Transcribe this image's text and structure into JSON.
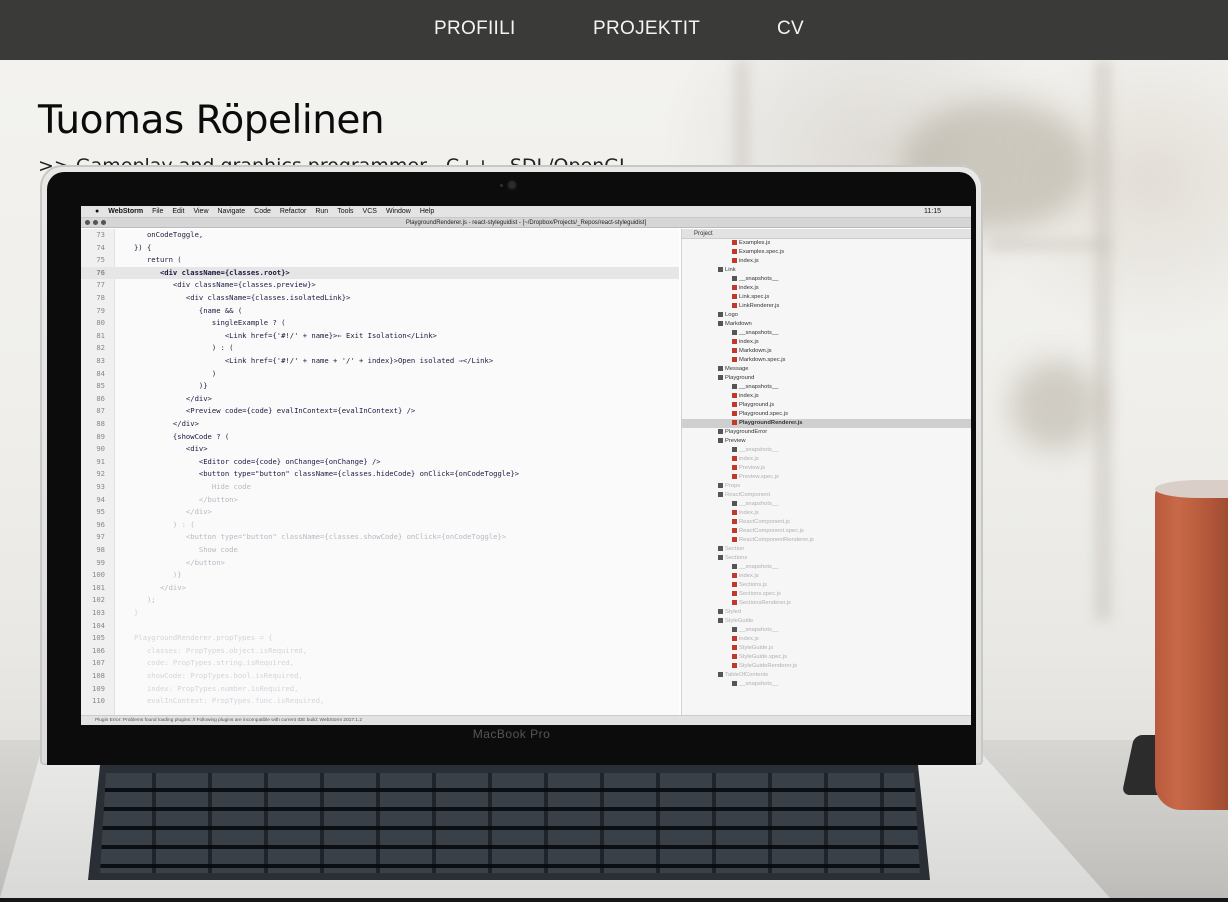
{
  "nav": {
    "items": [
      {
        "label": "PROFIILI"
      },
      {
        "label": "PROJEKTIT"
      },
      {
        "label": "CV"
      }
    ]
  },
  "hero": {
    "name": "Tuomas Röpelinen",
    "tagline": ">> Gameplay and graphics programmer - C++ - SDL/OpenGL"
  },
  "laptop": {
    "brand": "MacBook Pro",
    "menubar": {
      "app": "WebStorm",
      "items": [
        "File",
        "Edit",
        "View",
        "Navigate",
        "Code",
        "Refactor",
        "Run",
        "Tools",
        "VCS",
        "Window",
        "Help"
      ],
      "clock": "11:15"
    },
    "window_title": "PlaygroundRenderer.js - react-styleguidist - [~/Dropbox/Projects/_Repos/react-styleguidist]",
    "project_header": "Project",
    "code_lines": [
      {
        "ln": "73",
        "text": "      onCodeToggle,"
      },
      {
        "ln": "74",
        "text": "   }) {"
      },
      {
        "ln": "75",
        "text": "      return ("
      },
      {
        "ln": "76",
        "text": "         <div className={classes.root}>"
      },
      {
        "ln": "77",
        "text": "            <div className={classes.preview}>"
      },
      {
        "ln": "78",
        "text": "               <div className={classes.isolatedLink}>"
      },
      {
        "ln": "79",
        "text": "                  {name && ("
      },
      {
        "ln": "80",
        "text": "                     singleExample ? ("
      },
      {
        "ln": "81",
        "text": "                        <Link href={'#!/' + name}>⇐ Exit Isolation</Link>"
      },
      {
        "ln": "82",
        "text": "                     ) : ("
      },
      {
        "ln": "83",
        "text": "                        <Link href={'#!/' + name + '/' + index}>Open isolated ⇒</Link>"
      },
      {
        "ln": "84",
        "text": "                     )"
      },
      {
        "ln": "85",
        "text": "                  )}"
      },
      {
        "ln": "86",
        "text": "               </div>"
      },
      {
        "ln": "87",
        "text": "               <Preview code={code} evalInContext={evalInContext} />"
      },
      {
        "ln": "88",
        "text": "            </div>"
      },
      {
        "ln": "89",
        "text": "            {showCode ? ("
      },
      {
        "ln": "90",
        "text": "               <div>"
      },
      {
        "ln": "91",
        "text": "                  <Editor code={code} onChange={onChange} />"
      },
      {
        "ln": "92",
        "text": "                  <button type=\"button\" className={classes.hideCode} onClick={onCodeToggle}>"
      },
      {
        "ln": "93",
        "text": "                     Hide code"
      },
      {
        "ln": "94",
        "text": "                  </button>"
      },
      {
        "ln": "95",
        "text": "               </div>"
      },
      {
        "ln": "96",
        "text": "            ) : ("
      },
      {
        "ln": "97",
        "text": "               <button type=\"button\" className={classes.showCode} onClick={onCodeToggle}>"
      },
      {
        "ln": "98",
        "text": "                  Show code"
      },
      {
        "ln": "99",
        "text": "               </button>"
      },
      {
        "ln": "100",
        "text": "            )}"
      },
      {
        "ln": "101",
        "text": "         </div>"
      },
      {
        "ln": "102",
        "text": "      );"
      },
      {
        "ln": "103",
        "text": "   }"
      },
      {
        "ln": "104",
        "text": ""
      },
      {
        "ln": "105",
        "text": "   PlaygroundRenderer.propTypes = {"
      },
      {
        "ln": "106",
        "text": "      classes: PropTypes.object.isRequired,"
      },
      {
        "ln": "107",
        "text": "      code: PropTypes.string.isRequired,"
      },
      {
        "ln": "108",
        "text": "      showCode: PropTypes.bool.isRequired,"
      },
      {
        "ln": "109",
        "text": "      index: PropTypes.number.isRequired,"
      },
      {
        "ln": "110",
        "text": "      evalInContext: PropTypes.func.isRequired,"
      }
    ],
    "tree": [
      {
        "label": "Examples.js",
        "type": "js"
      },
      {
        "label": "Examples.spec.js",
        "type": "js"
      },
      {
        "label": "index.js",
        "type": "js"
      },
      {
        "label": "Link",
        "type": "dir"
      },
      {
        "label": "__snapshots__",
        "type": "dir"
      },
      {
        "label": "index.js",
        "type": "js"
      },
      {
        "label": "Link.spec.js",
        "type": "js"
      },
      {
        "label": "LinkRenderer.js",
        "type": "js"
      },
      {
        "label": "Logo",
        "type": "dir"
      },
      {
        "label": "Markdown",
        "type": "dir"
      },
      {
        "label": "__snapshots__",
        "type": "dir"
      },
      {
        "label": "index.js",
        "type": "js"
      },
      {
        "label": "Markdown.js",
        "type": "js"
      },
      {
        "label": "Markdown.spec.js",
        "type": "js"
      },
      {
        "label": "Message",
        "type": "dir"
      },
      {
        "label": "Playground",
        "type": "dir"
      },
      {
        "label": "__snapshots__",
        "type": "dir"
      },
      {
        "label": "index.js",
        "type": "js"
      },
      {
        "label": "Playground.js",
        "type": "js"
      },
      {
        "label": "Playground.spec.js",
        "type": "js"
      },
      {
        "label": "PlaygroundRenderer.js",
        "type": "js"
      },
      {
        "label": "PlaygroundError",
        "type": "dir"
      },
      {
        "label": "Preview",
        "type": "dir"
      },
      {
        "label": "__snapshots__",
        "type": "dir"
      },
      {
        "label": "index.js",
        "type": "js"
      },
      {
        "label": "Preview.js",
        "type": "js"
      },
      {
        "label": "Preview.spec.js",
        "type": "js"
      },
      {
        "label": "Props",
        "type": "dir"
      },
      {
        "label": "ReactComponent",
        "type": "dir"
      },
      {
        "label": "__snapshots__",
        "type": "dir"
      },
      {
        "label": "index.js",
        "type": "js"
      },
      {
        "label": "ReactComponent.js",
        "type": "js"
      },
      {
        "label": "ReactComponent.spec.js",
        "type": "js"
      },
      {
        "label": "ReactComponentRenderer.js",
        "type": "js"
      },
      {
        "label": "Section",
        "type": "dir"
      },
      {
        "label": "Sections",
        "type": "dir"
      },
      {
        "label": "__snapshots__",
        "type": "dir"
      },
      {
        "label": "index.js",
        "type": "js"
      },
      {
        "label": "Sections.js",
        "type": "js"
      },
      {
        "label": "Sections.spec.js",
        "type": "js"
      },
      {
        "label": "SectionsRenderer.js",
        "type": "js"
      },
      {
        "label": "Styled",
        "type": "dir"
      },
      {
        "label": "StyleGuide",
        "type": "dir"
      },
      {
        "label": "__snapshots__",
        "type": "dir"
      },
      {
        "label": "index.js",
        "type": "js"
      },
      {
        "label": "StyleGuide.js",
        "type": "js"
      },
      {
        "label": "StyleGuide.spec.js",
        "type": "js"
      },
      {
        "label": "StyleGuideRenderer.js",
        "type": "js"
      },
      {
        "label": "TableOfContents",
        "type": "dir"
      },
      {
        "label": "__snapshots__",
        "type": "dir"
      }
    ],
    "status_text": "Plugin Error: Problems found loading plugins: // Following plugins are incompatible with current IDE build: WebStorm 2017.1.2"
  },
  "colors": {
    "nav_bg": "#3a3a38",
    "nav_text": "#f4f4f4",
    "heading": "#0b0b0b"
  }
}
